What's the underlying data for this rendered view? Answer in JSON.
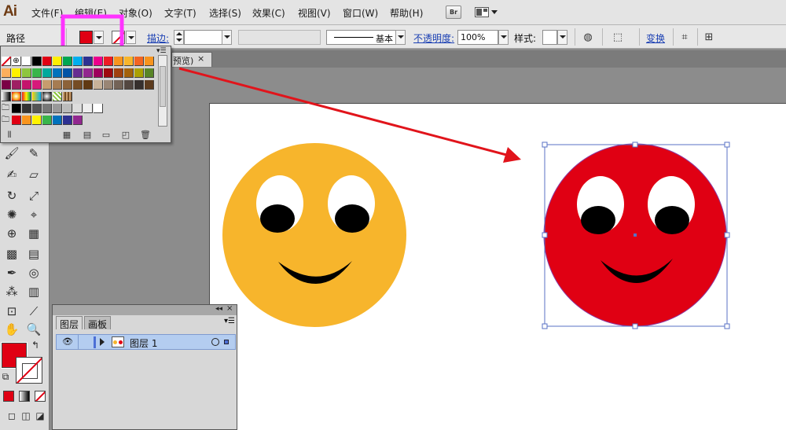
{
  "app": {
    "logo": "Ai"
  },
  "menu": [
    {
      "label": "文件(F)",
      "icon": ""
    },
    {
      "label": "编辑(E)"
    },
    {
      "label": "对象(O)"
    },
    {
      "label": "文字(T)"
    },
    {
      "label": "选择(S)"
    },
    {
      "label": "效果(C)"
    },
    {
      "label": "视图(V)"
    },
    {
      "label": "窗口(W)"
    },
    {
      "label": "帮助(H)"
    }
  ],
  "bridge_button": "Br",
  "control_bar": {
    "selection_label": "路径",
    "fill_color": "#e00013",
    "stroke_link": "描边:",
    "stroke_weight": "",
    "variable_width": "",
    "stroke_profile": "基本",
    "opacity_link": "不透明度:",
    "opacity_value": "100%",
    "style_label": "样式:",
    "transform_link": "变换"
  },
  "document": {
    "tab_title": "预览)",
    "tab_close": "×"
  },
  "layers_panel": {
    "tabs": [
      "图层",
      "画板"
    ],
    "layer_name": "图层 1"
  },
  "colors": {
    "annotation_magenta": "#ff33ff",
    "arrow_red": "#e1141b",
    "yellow_face": "#f7b52c",
    "red_face": "#e00013",
    "selection_blue": "#5872c6"
  },
  "icons": {
    "eye": "eye-icon",
    "trash": "trash-icon",
    "globe": "globe-icon"
  }
}
